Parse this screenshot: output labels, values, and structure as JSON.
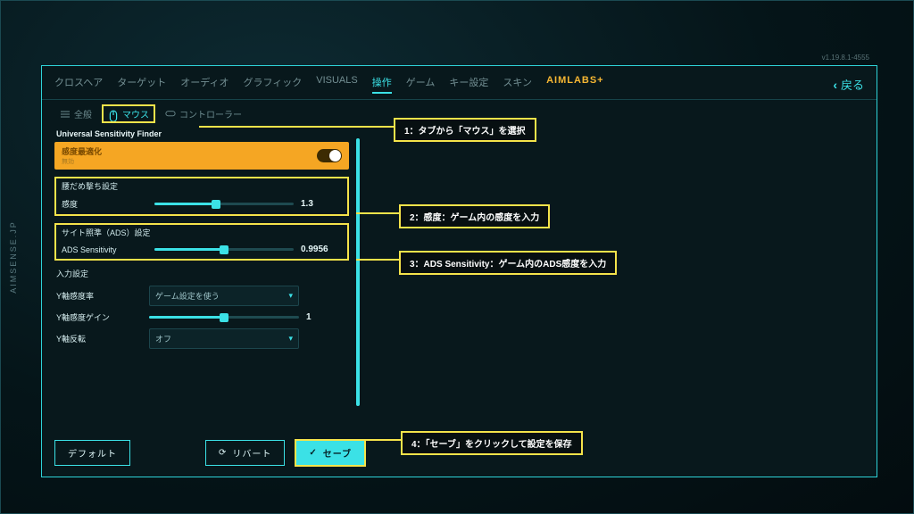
{
  "watermark": "AIMSENSE.JP",
  "version": "v1.19.8.1-4555",
  "header": {
    "tabs": [
      "クロスヘア",
      "ターゲット",
      "オーディオ",
      "グラフィック",
      "VISUALS",
      "操作",
      "ゲーム",
      "キー設定",
      "スキン",
      "AIMLABS+"
    ],
    "active_tab_index": 5,
    "back_label": "戻る"
  },
  "subtabs": {
    "items": [
      "全般",
      "マウス",
      "コントローラー"
    ],
    "active_index": 1
  },
  "usf": {
    "title": "Universal Sensitivity Finder",
    "toggle_label": "感度最適化",
    "toggle_sub": "無効"
  },
  "sections": {
    "hipfire": {
      "header": "腰だめ撃ち設定",
      "sensitivity_label": "感度",
      "sensitivity_value": "1.3",
      "sensitivity_fill_pct": 44
    },
    "ads": {
      "header": "サイト照準（ADS）設定",
      "label": "ADS Sensitivity",
      "value": "0.9956",
      "fill_pct": 50
    },
    "input": {
      "header": "入力設定",
      "y_ratio_label": "Y軸感度率",
      "y_ratio_value": "ゲーム設定を使う",
      "y_gain_label": "Y軸感度ゲイン",
      "y_gain_value": "1",
      "y_gain_fill_pct": 50,
      "y_invert_label": "Y軸反転",
      "y_invert_value": "オフ"
    }
  },
  "buttons": {
    "default": "デフォルト",
    "revert": "リバート",
    "save": "セーブ"
  },
  "callouts": {
    "c1": "1：タブから「マウス」を選択",
    "c2": "2：感度：ゲーム内の感度を入力",
    "c3": "3：ADS Sensitivity：ゲーム内のADS感度を入力",
    "c4": "4：「セーブ」をクリックして設定を保存"
  }
}
